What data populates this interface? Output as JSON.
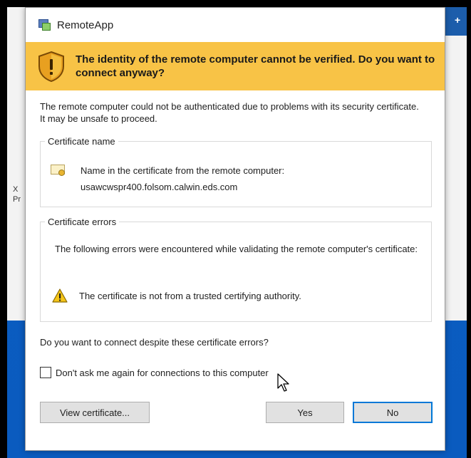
{
  "window": {
    "title": "RemoteApp",
    "icon": "remoteapp-icon"
  },
  "banner": {
    "icon": "warning-shield-icon",
    "text": "The identity of the remote computer cannot be verified. Do you want to connect anyway?",
    "color": "#f8c346"
  },
  "description": "The remote computer could not be authenticated due to problems with its security certificate. It may be unsafe to proceed.",
  "certificate_name": {
    "legend": "Certificate name",
    "icon": "certificate-icon",
    "line1": "Name in the certificate from the remote computer:",
    "line2": "usawcwspr400.folsom.calwin.eds.com"
  },
  "certificate_errors": {
    "legend": "Certificate errors",
    "intro": "The following errors were encountered while validating the remote computer's certificate:",
    "icon": "warning-icon",
    "error": "The certificate is not from a trusted certifying authority."
  },
  "question": "Do you want to connect despite these certificate errors?",
  "checkbox": {
    "label": "Don't ask me again for connections to this computer",
    "checked": false
  },
  "buttons": {
    "view_certificate": "View certificate...",
    "yes": "Yes",
    "no": "No"
  },
  "desktop_fragments": {
    "a": "X",
    "b": "Pr"
  }
}
